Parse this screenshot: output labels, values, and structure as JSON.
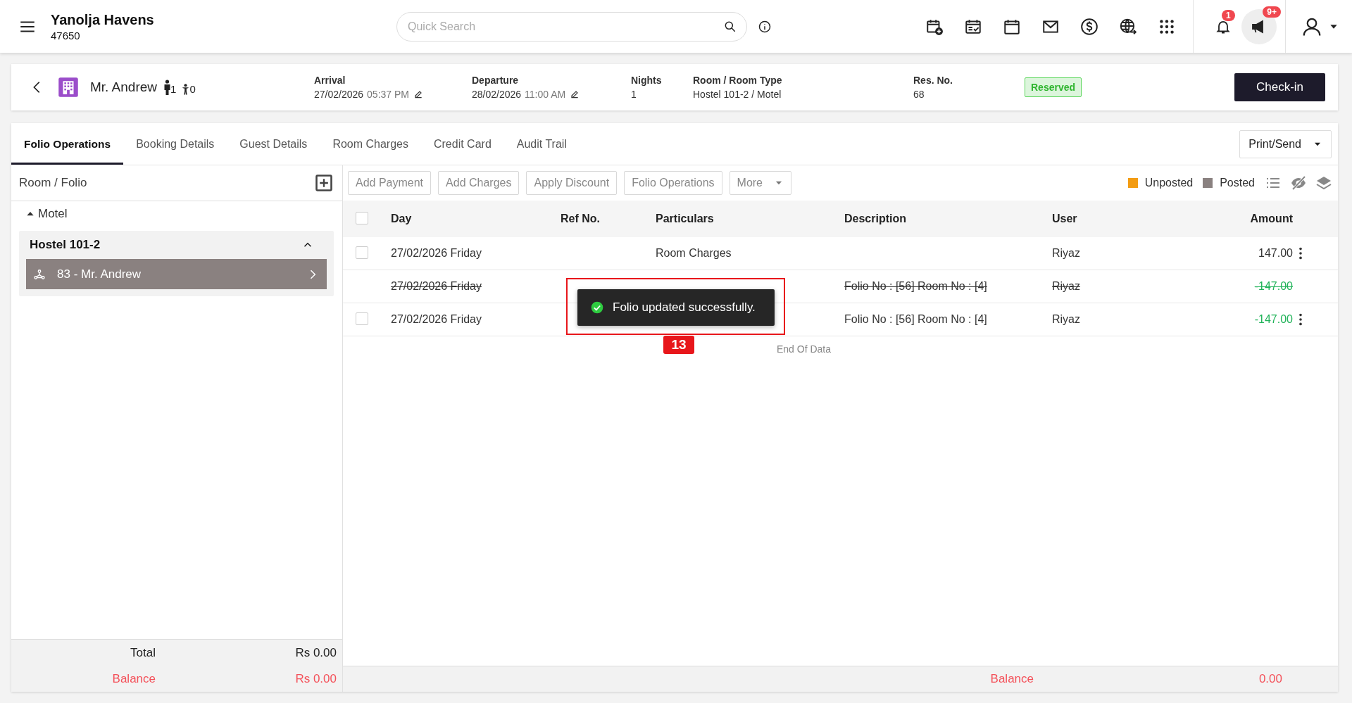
{
  "app": {
    "title": "Yanolja Havens",
    "property_id": "47650"
  },
  "search": {
    "placeholder": "Quick Search"
  },
  "notifications": {
    "bell_count": "1",
    "announcement_count": "9+"
  },
  "reservation": {
    "guest_name": "Mr. Andrew",
    "adults": "1",
    "children": "0",
    "fields": [
      {
        "label": "Arrival",
        "value": "27/02/2026",
        "time": "05:37 PM",
        "editable": true
      },
      {
        "label": "Departure",
        "value": "28/02/2026",
        "time": "11:00 AM",
        "editable": true
      },
      {
        "label": "Nights",
        "value": "1",
        "editable": false
      },
      {
        "label": "Room / Room Type",
        "value": "Hostel 101-2 / Motel",
        "editable": false
      },
      {
        "label": "Res. No.",
        "value": "68",
        "editable": false
      }
    ],
    "status": "Reserved",
    "action": "Check-in"
  },
  "tabs": [
    {
      "label": "Folio Operations",
      "selected": true
    },
    {
      "label": "Booking Details",
      "selected": false
    },
    {
      "label": "Guest Details",
      "selected": false
    },
    {
      "label": "Room Charges",
      "selected": false
    },
    {
      "label": "Credit Card",
      "selected": false
    },
    {
      "label": "Audit Trail",
      "selected": false
    }
  ],
  "print_button": "Print/Send",
  "room_folio": {
    "title": "Room / Folio",
    "tree": [
      {
        "label": "Motel",
        "expanded": true,
        "children": [
          {
            "label": "Hostel 101-2",
            "expanded": true,
            "children": [
              {
                "label": "83 - Mr. Andrew",
                "selected": true
              }
            ]
          }
        ]
      }
    ],
    "totals": [
      {
        "kind": "total",
        "label": "Total",
        "value": "Rs 0.00"
      },
      {
        "kind": "balance",
        "label": "Balance",
        "value": "Rs 0.00"
      }
    ]
  },
  "toolbar": {
    "buttons": [
      {
        "kind": "button",
        "label": "Add Payment"
      },
      {
        "kind": "button",
        "label": "Add Charges"
      },
      {
        "kind": "button",
        "label": "Apply Discount"
      },
      {
        "kind": "button",
        "label": "Folio Operations"
      },
      {
        "kind": "dropdown",
        "label": "More"
      }
    ],
    "legend": [
      {
        "label": "Unposted",
        "color": "#f39c12"
      },
      {
        "label": "Posted",
        "color": "#8a8180"
      }
    ]
  },
  "table": {
    "select_all_checked": false,
    "columns": [
      "Day",
      "Ref No.",
      "Particulars",
      "Description",
      "User",
      "Amount"
    ],
    "rows": [
      {
        "kind": "entry",
        "checked": false,
        "day": "27/02/2026 Friday",
        "particulars": "Room Charges",
        "user": "Riyaz",
        "amount": "147.00",
        "credit": false
      },
      {
        "kind": "voided",
        "day": "27/02/2026 Friday",
        "description": "Folio No : [56] Room No : [4]",
        "user": "Riyaz",
        "amount": "-147.00",
        "credit": true
      },
      {
        "kind": "entry",
        "checked": false,
        "day": "27/02/2026 Friday",
        "description": "Folio No : [56] Room No : [4]",
        "user": "Riyaz",
        "amount": "-147.00",
        "credit": true
      }
    ],
    "end_text": "End Of Data"
  },
  "footer": {
    "label": "Balance",
    "value": "0.00"
  },
  "toast": {
    "message": "Folio updated successfully."
  },
  "annotation": {
    "label": "13"
  }
}
